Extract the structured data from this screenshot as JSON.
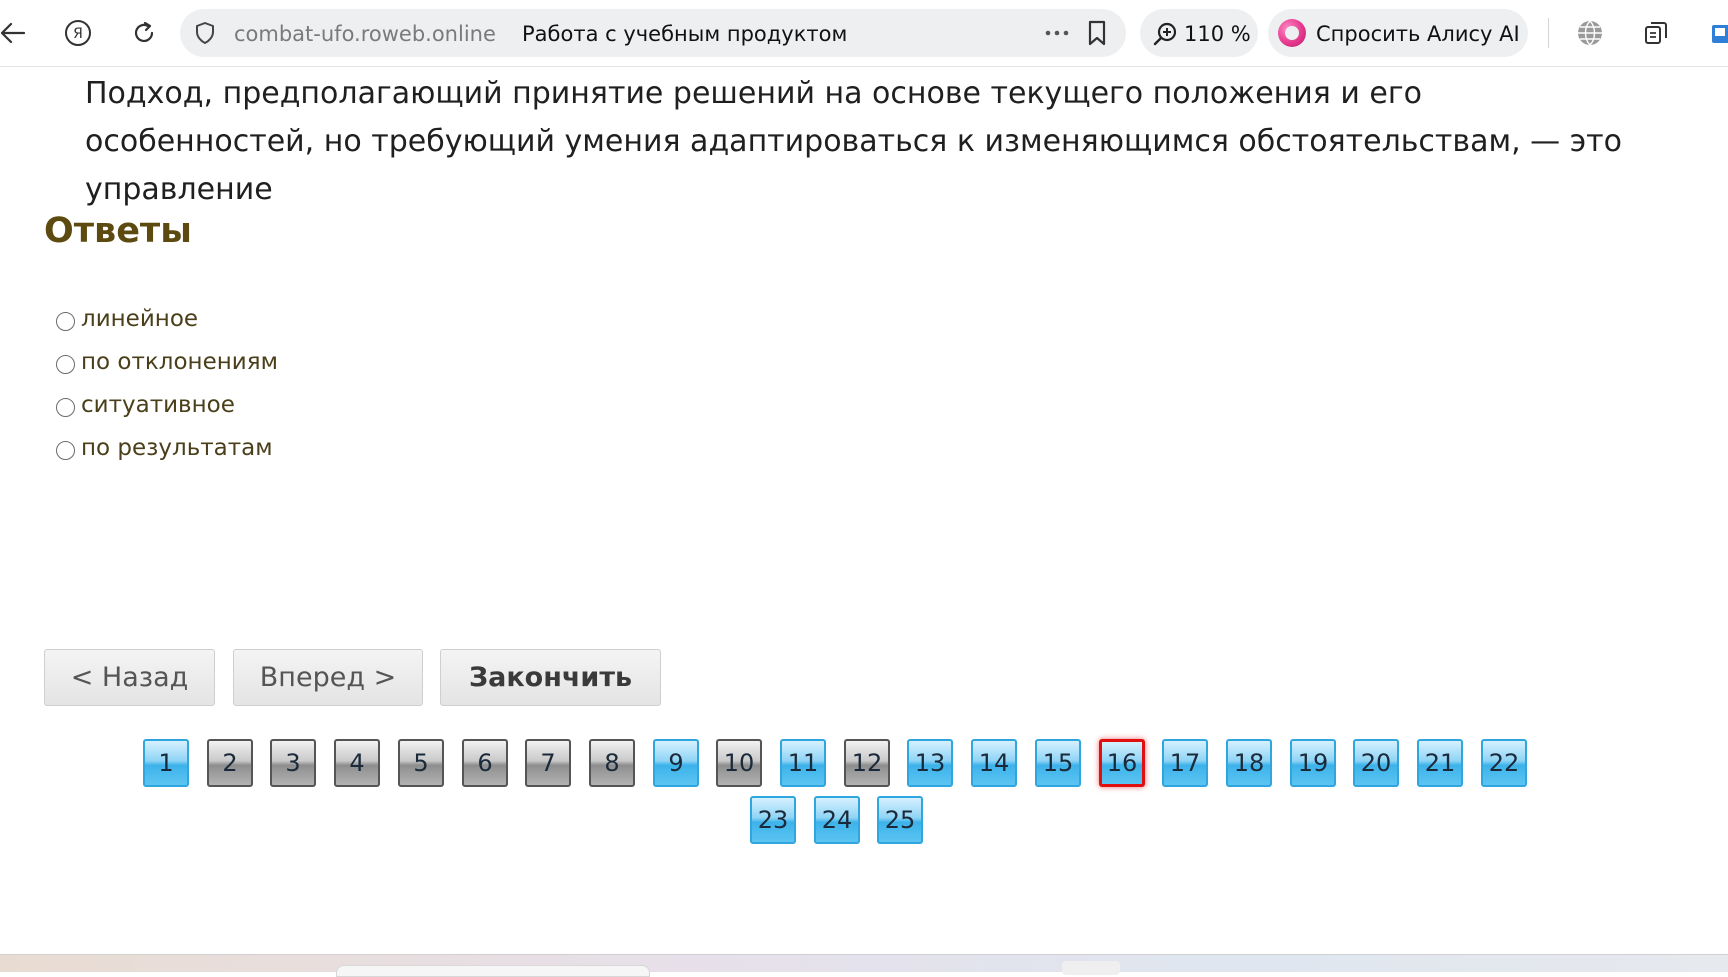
{
  "browser": {
    "domain": "combat-ufo.roweb.online",
    "page_title": "Работа с учебным продуктом",
    "zoom": "110 %",
    "alice_label": "Спросить Алису AI"
  },
  "question": {
    "text": "Подход, предполагающий принятие решений на основе текущего положения и его особенностей, но требующий умения адаптироваться к изменяющимся обстоятельствам, — это управление"
  },
  "answers": {
    "heading": "Ответы",
    "options": [
      {
        "label": "линейное",
        "selected": false
      },
      {
        "label": "по отклонениям",
        "selected": false
      },
      {
        "label": "ситуативное",
        "selected": false
      },
      {
        "label": "по результатам",
        "selected": false
      }
    ]
  },
  "nav": {
    "back": "< Назад",
    "forward": "Вперед >",
    "finish": "Закончить"
  },
  "pagination": {
    "current": 16,
    "pages": [
      {
        "label": "1",
        "state": "answered"
      },
      {
        "label": "2",
        "state": "unanswered"
      },
      {
        "label": "3",
        "state": "unanswered"
      },
      {
        "label": "4",
        "state": "unanswered"
      },
      {
        "label": "5",
        "state": "unanswered"
      },
      {
        "label": "6",
        "state": "unanswered"
      },
      {
        "label": "7",
        "state": "unanswered"
      },
      {
        "label": "8",
        "state": "unanswered"
      },
      {
        "label": "9",
        "state": "answered"
      },
      {
        "label": "10",
        "state": "unanswered"
      },
      {
        "label": "11",
        "state": "answered"
      },
      {
        "label": "12",
        "state": "unanswered"
      },
      {
        "label": "13",
        "state": "answered"
      },
      {
        "label": "14",
        "state": "answered"
      },
      {
        "label": "15",
        "state": "answered"
      },
      {
        "label": "16",
        "state": "current"
      },
      {
        "label": "17",
        "state": "answered"
      },
      {
        "label": "18",
        "state": "answered"
      },
      {
        "label": "19",
        "state": "answered"
      },
      {
        "label": "20",
        "state": "answered"
      },
      {
        "label": "21",
        "state": "answered"
      },
      {
        "label": "22",
        "state": "answered"
      },
      {
        "label": "23",
        "state": "answered"
      },
      {
        "label": "24",
        "state": "answered"
      },
      {
        "label": "25",
        "state": "answered"
      }
    ]
  }
}
